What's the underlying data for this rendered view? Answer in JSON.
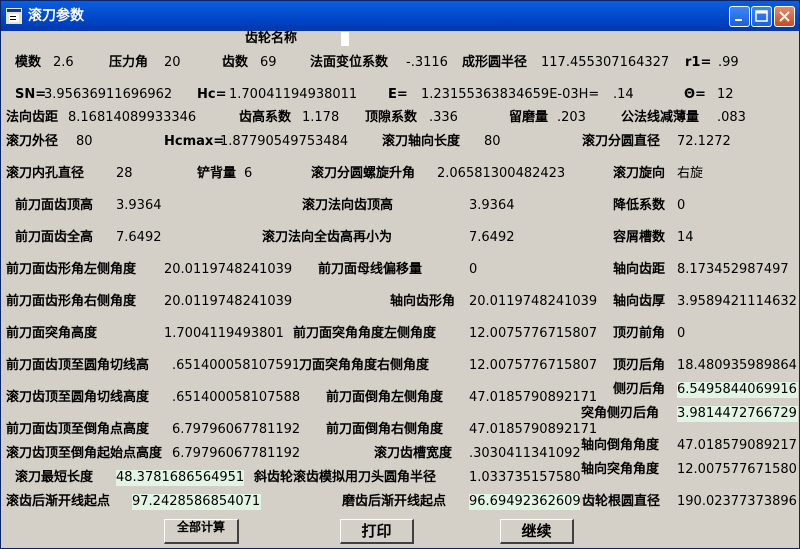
{
  "window": {
    "title": "滚刀参数",
    "minimize_label": "最小化",
    "maximize_label": "最大化",
    "close_label": "关闭"
  },
  "gear_name_label": "齿轮名称",
  "rows": [
    [
      {
        "label": "模数",
        "value": "2.6"
      },
      {
        "label": "压力角",
        "value": "20"
      },
      {
        "label": "齿数",
        "value": "69"
      },
      {
        "label": "法面变位系数",
        "value": "-.3116"
      },
      {
        "label": "成形圆半径",
        "value": "117.455307164327"
      },
      {
        "label": "r1=",
        "value": ".99"
      }
    ],
    [
      {
        "label": "SN=",
        "value": "3.95636911696962"
      },
      {
        "label": "Hc=",
        "value": "1.70041194938011"
      },
      {
        "label": "E=",
        "value": "1.23155363834659E-03H="
      },
      {
        "label": "",
        "value": ".14"
      },
      {
        "label": "Θ=",
        "value": "12"
      }
    ],
    [
      {
        "label": "法向齿距",
        "value": "8.16814089933346"
      },
      {
        "label": "齿高系数",
        "value": "1.178"
      },
      {
        "label": "顶隙系数",
        "value": ".336"
      },
      {
        "label": "留磨量",
        "value": ".203"
      },
      {
        "label": "公法线减薄量",
        "value": ".083"
      }
    ],
    [
      {
        "label": "滚刀外径",
        "value": "80"
      },
      {
        "label": "Hcmax=",
        "value": "1.87790549753484"
      },
      {
        "label": "滚刀轴向长度",
        "value": "80"
      },
      {
        "label": "滚刀分圆直径",
        "value": "72.1272"
      }
    ],
    [
      {
        "label": "滚刀内孔直径",
        "value": "28"
      },
      {
        "label": "铲背量",
        "value": "6"
      },
      {
        "label": "滚刀分圆螺旋升角",
        "value": "2.06581300482423"
      },
      {
        "label": "滚刀旋向",
        "value": "右旋"
      }
    ],
    [
      {
        "label": "前刀面齿顶高",
        "value": "3.9364"
      },
      {
        "label": "滚刀法向齿顶高",
        "value": "3.9364"
      },
      {
        "label": "降低系数",
        "value": "0"
      }
    ],
    [
      {
        "label": "前刀面齿全高",
        "value": "7.6492"
      },
      {
        "label": "滚刀法向全齿高再小为",
        "value": "7.6492"
      },
      {
        "label": "容屑槽数",
        "value": "14"
      }
    ],
    [
      {
        "label": "前刀面齿形角左侧角度",
        "value": "20.0119748241039"
      },
      {
        "label": "前刀面母线偏移量",
        "value": "0"
      },
      {
        "label": "轴向齿距",
        "value": "8.173452987497"
      }
    ],
    [
      {
        "label": "前刀面齿形角右侧角度",
        "value": "20.0119748241039"
      },
      {
        "label": "轴向齿形角",
        "value": "20.0119748241039"
      },
      {
        "label": "轴向齿厚",
        "value": "3.9589421114632"
      }
    ],
    [
      {
        "label": "前刀面突角高度",
        "value": "1.7004119493801"
      },
      {
        "label": "前刀面突角角度左侧角度",
        "value": "12.0075776715807"
      },
      {
        "label": "顶刃前角",
        "value": "0"
      }
    ],
    [
      {
        "label": "前刀面齿顶至圆角切线高",
        "value": ".651400058107591"
      },
      {
        "label": "刀面突角角度右侧角度",
        "value": "12.0075776715807"
      },
      {
        "label": "顶刃后角",
        "value": "18.480935989864"
      }
    ],
    [
      {
        "label": "滚刀齿顶至圆角切线高度",
        "value": ".651400058107588"
      },
      {
        "label": "前刀面倒角左侧角度",
        "value": "47.0185790892171"
      },
      {
        "label": "侧刃后角",
        "value": "6.5495844069916"
      }
    ],
    [
      {
        "label": "前刀面齿顶至倒角点高度",
        "value": "6.79796067781192"
      },
      {
        "label": "前刀面倒角右侧角度",
        "value": "47.0185790892171"
      },
      {
        "label": "突角侧刃后角",
        "value": "3.9814472766729"
      }
    ],
    [
      {
        "label": "滚刀齿顶至倒角起始点高度",
        "value": "6.79796067781192"
      },
      {
        "label": "滚刀齿槽宽度",
        "value": ".303041134109299"
      },
      {
        "label": "轴向倒角角度",
        "value": "47.018579089217"
      }
    ],
    [
      {
        "label": "滚刀最短长度",
        "value": "48.3781686564951"
      },
      {
        "label": "斜齿轮滚齿模拟用刀头圆角半径",
        "value": "1.03373515758052"
      },
      {
        "label": "轴向突角角度",
        "value": "12.007577671580"
      }
    ],
    [
      {
        "label": "滚齿后渐开线起点",
        "value": "97.2428586854071"
      },
      {
        "label": "磨齿后渐开线起点",
        "value": "96.69492362609"
      },
      {
        "label": "齿轮根圆直径",
        "value": "190.02377373896"
      }
    ]
  ],
  "buttons": {
    "full_calc": "全部计算",
    "print": "打印",
    "continue": "继续"
  }
}
